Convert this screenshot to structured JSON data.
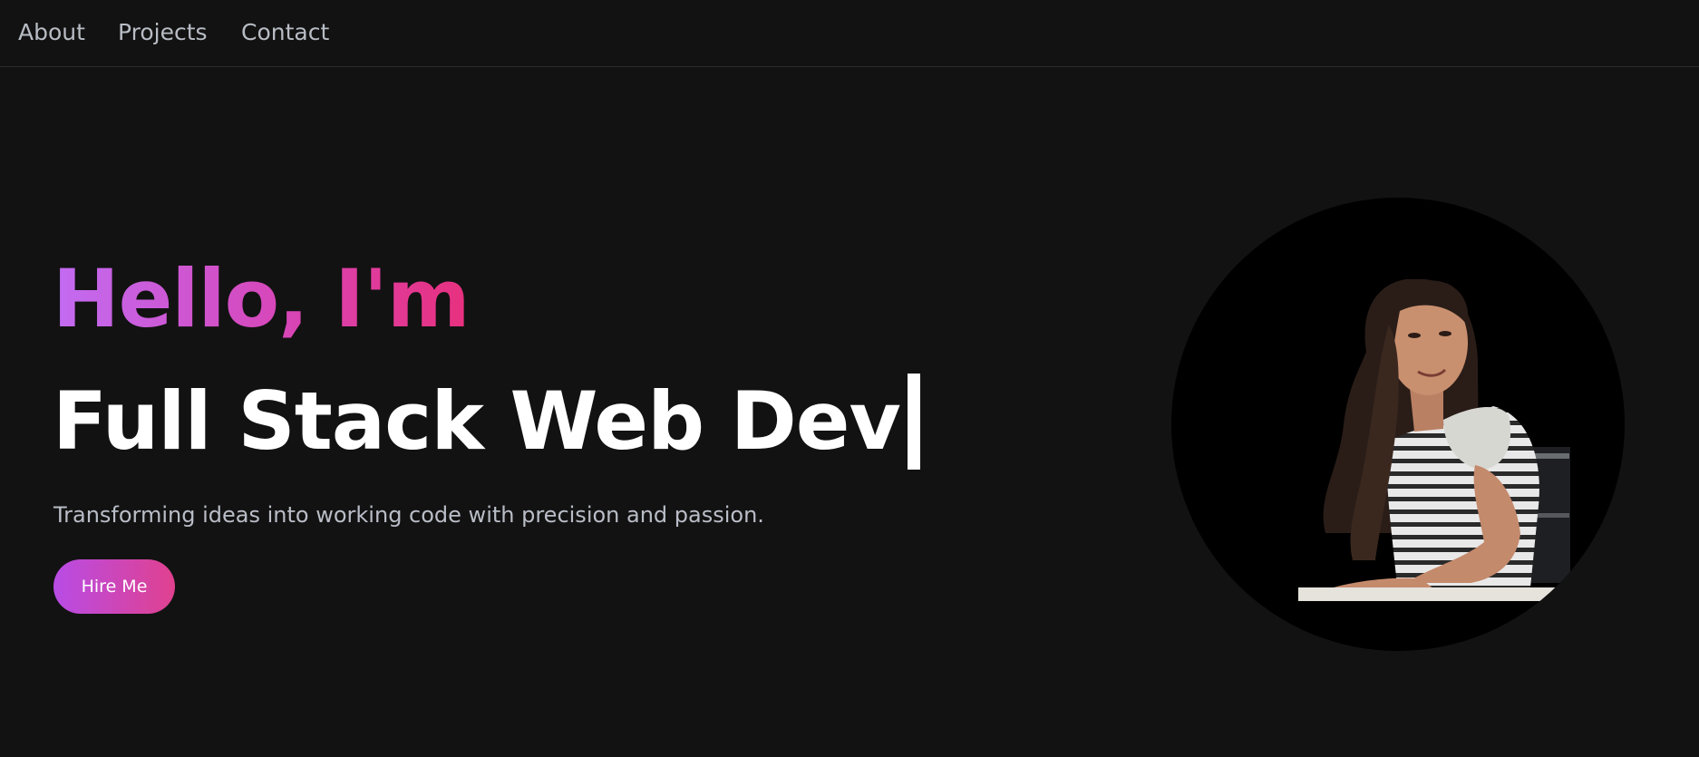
{
  "nav": {
    "items": [
      {
        "label": "About"
      },
      {
        "label": "Projects"
      },
      {
        "label": "Contact"
      }
    ]
  },
  "hero": {
    "greeting": "Hello, I'm",
    "title": "Full Stack Web Dev",
    "tagline": "Transforming ideas into working code with precision and passion.",
    "cta_label": "Hire Me"
  },
  "colors": {
    "background": "#121212",
    "accent_start": "#c26cf3",
    "accent_end": "#e8307e"
  }
}
